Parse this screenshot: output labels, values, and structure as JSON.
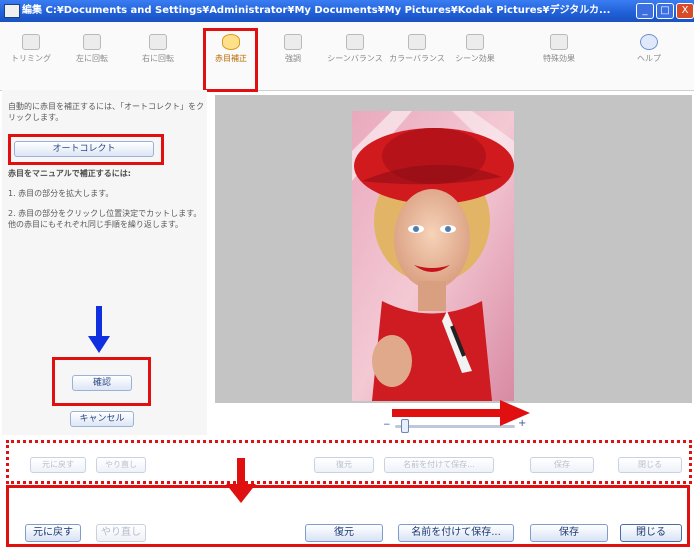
{
  "window": {
    "title": "編集 C:¥Documents and Settings¥Administrator¥My Documents¥My Pictures¥Kodak Pictures¥デジタルカ...",
    "minimize": "_",
    "maximize": "□",
    "close": "X"
  },
  "toolbar": {
    "items": [
      {
        "label": "トリミング",
        "icon": "crop-icon"
      },
      {
        "label": "左に回転",
        "icon": "rotate-left-icon"
      },
      {
        "label": "右に回転",
        "icon": "rotate-right-icon"
      },
      {
        "label": "赤目補正",
        "icon": "red-eye-icon",
        "active": true
      },
      {
        "label": "強調",
        "icon": "enhance-icon"
      },
      {
        "label": "シーンバランス",
        "icon": "scene-balance-icon"
      },
      {
        "label": "カラーバランス",
        "icon": "color-balance-icon"
      },
      {
        "label": "シーン効果",
        "icon": "scene-effect-icon"
      },
      {
        "label": "特殊効果",
        "icon": "special-effect-icon"
      },
      {
        "label": "ヘルプ",
        "icon": "help-icon"
      }
    ]
  },
  "left_panel": {
    "auto_instruction": "自動的に赤目を補正するには、「オートコレクト」をクリックします。",
    "autocorrect_button": "オートコレクト",
    "manual_heading": "赤目をマニュアルで補正するには:",
    "step1": "1. 赤目の部分を拡大します。",
    "step2": "2. 赤目の部分をクリックし位置決定でカットします。他の赤目にもそれぞれ同じ手順を繰り返します。",
    "confirm_button": "確認",
    "cancel_button": "キャンセル"
  },
  "ghost_bar": {
    "undo": "元に戻す",
    "redo": "やり直し",
    "restore": "復元",
    "save_as": "名前を付けて保存...",
    "save": "保存",
    "close": "閉じる"
  },
  "bottom_bar": {
    "undo": "元に戻す",
    "redo": "やり直し",
    "restore": "復元",
    "save_as": "名前を付けて保存...",
    "save": "保存",
    "close": "閉じる"
  },
  "colors": {
    "annotation_red": "#e01010",
    "annotation_blue": "#1030e0",
    "titlebar_blue": "#1f5fd6"
  },
  "zoom": {
    "level": 0.1
  }
}
